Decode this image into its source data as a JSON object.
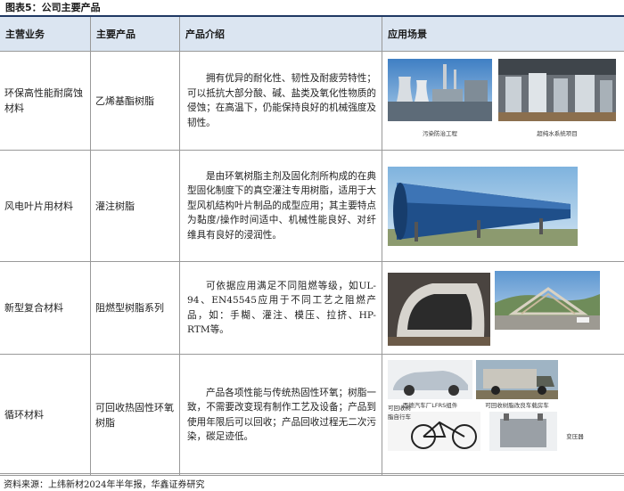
{
  "title": "图表5：公司主要产品",
  "headers": [
    "主营业务",
    "主要产品",
    "产品介绍",
    "应用场景"
  ],
  "rows": [
    {
      "business": "环保高性能耐腐蚀材料",
      "product": "乙烯基酯树脂",
      "intro": "拥有优异的耐化性、韧性及耐疲劳特性；可以抵抗大部分酸、碱、盐类及氧化性物质的侵蚀；在高温下，仍能保持良好的机械强度及韧性。",
      "captions": [
        "污染防治工程",
        "超纯水系统项目"
      ]
    },
    {
      "business": "风电叶片用材料",
      "product": "灌注树脂",
      "intro": "是由环氧树脂主剂及固化剂所构成的在典型固化制度下的真空灌注专用树脂，适用于大型风机结构叶片制品的成型应用；其主要特点为黏度/操作时间适中、机械性能良好、对纤维具有良好的浸润性。",
      "captions": []
    },
    {
      "business": "新型复合材料",
      "product": "阻燃型树脂系列",
      "intro": "可依据应用满足不同阻燃等级，如UL-94、EN45545应用于不同工艺之阻燃产品，如：手糊、灌注、模压、拉挤、HP-RTM等。",
      "captions": []
    },
    {
      "business": "循环材料",
      "product": "可回收热固性环氧树脂",
      "intro": "产品各项性能与传统热固性环氧；树脂一致，不需要改变现有制作工艺及设备；产品到使用年限后可以回收；产品回收过程无二次污染，碳足迹低。",
      "captions": [
        "西德汽车厂LFRS组件",
        "可回收树脂改良车载房车",
        "可回收树脂自行车",
        "变压器"
      ]
    }
  ],
  "source": "资料来源：上纬新材2024年半年报，华鑫证券研究"
}
